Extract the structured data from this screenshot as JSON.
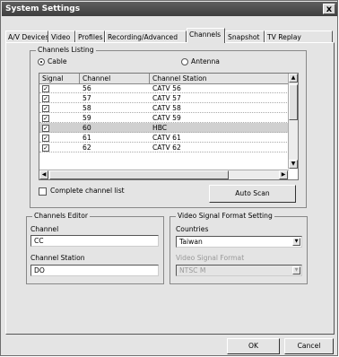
{
  "window": {
    "title": "System Settings",
    "close_glyph": "x"
  },
  "tabs": [
    {
      "label": "A/V Devices",
      "active": false
    },
    {
      "label": "Video",
      "active": false
    },
    {
      "label": "Profiles",
      "active": false
    },
    {
      "label": "Recording/Advanced",
      "active": false
    },
    {
      "label": "Channels",
      "active": true
    },
    {
      "label": "Snapshot",
      "active": false
    },
    {
      "label": "TV Replay",
      "active": false
    }
  ],
  "channels_listing": {
    "group_title": "Channels Listing",
    "source_options": [
      {
        "label": "Cable",
        "selected": true
      },
      {
        "label": "Antenna",
        "selected": false
      }
    ],
    "columns": [
      "Signal",
      "Channel",
      "Channel Station"
    ],
    "rows": [
      {
        "signal_checked": true,
        "channel": "56",
        "station": "CATV 56",
        "selected": false
      },
      {
        "signal_checked": true,
        "channel": "57",
        "station": "CATV 57",
        "selected": false
      },
      {
        "signal_checked": true,
        "channel": "58",
        "station": "CATV 58",
        "selected": false
      },
      {
        "signal_checked": true,
        "channel": "59",
        "station": "CATV 59",
        "selected": false
      },
      {
        "signal_checked": true,
        "channel": "60",
        "station": "HBC",
        "selected": true
      },
      {
        "signal_checked": true,
        "channel": "61",
        "station": "CATV 61",
        "selected": false
      },
      {
        "signal_checked": true,
        "channel": "62",
        "station": "CATV 62",
        "selected": false
      }
    ],
    "check_glyph": "✓",
    "complete_list_label": "Complete channel list",
    "complete_list_checked": false,
    "auto_scan_label": "Auto Scan"
  },
  "channels_editor": {
    "group_title": "Channels Editor",
    "channel_label": "Channel",
    "channel_value": "CC",
    "station_label": "Channel Station",
    "station_value": "DO"
  },
  "video_signal": {
    "group_title": "Video Signal Format Setting",
    "countries_label": "Countries",
    "countries_value": "Taiwan",
    "format_label": "Video Signal Format",
    "format_value": "NTSC M"
  },
  "footer": {
    "ok_label": "OK",
    "cancel_label": "Cancel"
  },
  "icons": {
    "scroll_up": "▲",
    "scroll_down": "▼",
    "scroll_left": "◀",
    "scroll_right": "▶",
    "dropdown": "▼"
  }
}
